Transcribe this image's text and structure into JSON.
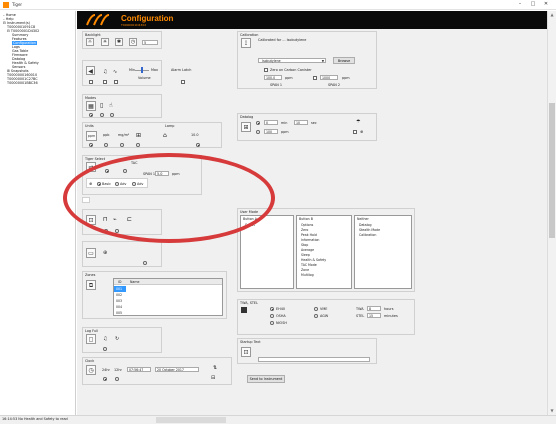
{
  "window": {
    "title": "Tiger",
    "minimize": "–",
    "maximize": "□",
    "close": "✕"
  },
  "tree": {
    "items": [
      {
        "label": "– Home",
        "level": 0
      },
      {
        "label": "– Help",
        "level": 0
      },
      {
        "label": "⊟ Instrument(s)",
        "level": 0
      },
      {
        "label": "T0000001091C8",
        "level": 1
      },
      {
        "label": "⊟ T0000001D4302",
        "level": 1
      },
      {
        "label": "Summary",
        "level": 2
      },
      {
        "label": "Features",
        "level": 2
      },
      {
        "label": "Configuration",
        "level": 2,
        "selected": true
      },
      {
        "label": "Logs",
        "level": 2
      },
      {
        "label": "Gas Table",
        "level": 2
      },
      {
        "label": "Firmware",
        "level": 2
      },
      {
        "label": "Datalog",
        "level": 2
      },
      {
        "label": "Health & Safety",
        "level": 2
      },
      {
        "label": "Sensors",
        "level": 2
      },
      {
        "label": "⊞ Snapshots",
        "level": 1
      },
      {
        "label": "T0000000160010",
        "level": 1
      },
      {
        "label": "T00000001C27BC",
        "level": 1
      },
      {
        "label": "T00000001BBC36",
        "level": 1
      }
    ]
  },
  "header": {
    "title": "Configuration",
    "subtitle": "T0000001D4302"
  },
  "backlight": {
    "title": "Backlight",
    "value": "5"
  },
  "sound": {
    "min": "Min",
    "max": "Max",
    "volume": "Volume",
    "alarm_latch": "Alarm Latch"
  },
  "modes": {
    "title": "Modes"
  },
  "units": {
    "title": "Units",
    "lamp": "Lamp",
    "u1": "ppm",
    "u2": "ppb",
    "u3": "mg/m³",
    "lamp_value": "10.0"
  },
  "tiger_select": {
    "title": "Tiger Select",
    "tac": "TAC",
    "span": "SPAN 1",
    "span_value": "5.0",
    "span_unit": "ppm",
    "basic": "Basic",
    "adv": "Adv",
    "adv2": "Adv"
  },
  "calibration": {
    "title": "Calibration",
    "calibrated_for": "Calibrated for ... Isobutylene",
    "gas": "Isobutylene",
    "browse": "Browse",
    "zero_carbon": "Zero on Carbon Canister",
    "span1_value": "100.0",
    "span1_unit": "ppm",
    "span2_value": "1000",
    "span2_unit": "ppm",
    "span1": "SPAN 1",
    "span2": "SPAN 2"
  },
  "datalog": {
    "title": "Datalog",
    "interval_value": "0",
    "interval_min": "min",
    "interval_sec_value": "10",
    "interval_sec": "sec",
    "threshold_value": "100",
    "threshold_unit": "ppm"
  },
  "user_mode": {
    "title": "User Mode",
    "button_a": "Button A",
    "button_b": "Button B",
    "neither": "Neither",
    "a_items": [
      "Select"
    ],
    "b_items": [
      "Options",
      "Zero",
      "Peak Hold",
      "Information",
      "Stop",
      "Average",
      "Sleep",
      "Health & Safety",
      "TAC Mode",
      "Zone",
      "Multilog"
    ],
    "n_items": [
      "Datalog",
      "Stealth Mode",
      "Calibration"
    ]
  },
  "twa_stel": {
    "title": "TWA, STEL",
    "ehae": "EH40",
    "osha": "OSHA",
    "niosh": "NIOSH",
    "vme": "VME",
    "agw": "AGW",
    "twa": "TWA",
    "twa_value": "8",
    "twa_unit": "hours",
    "stel": "STEL",
    "stel_value": "15",
    "stel_unit": "minutes"
  },
  "zones": {
    "title": "Zones",
    "col_id": "ID",
    "col_name": "Name",
    "rows": [
      "001",
      "002",
      "003",
      "004",
      "005"
    ]
  },
  "log_full": {
    "title": "Log Full"
  },
  "startup_text": {
    "title": "Startup Text"
  },
  "clock": {
    "title": "Clock",
    "h24": "24hr",
    "h12": "12hr",
    "time": "07:56:47",
    "date": "20 October 2017"
  },
  "send_button": "Send to Instrument",
  "status_text": "16:14:53 No Health and Safety to read",
  "colors": {
    "accent": "#ff8a00",
    "header_bg": "#0a0a0a",
    "selection": "#3399ff",
    "annotation": "#d63a3a"
  }
}
